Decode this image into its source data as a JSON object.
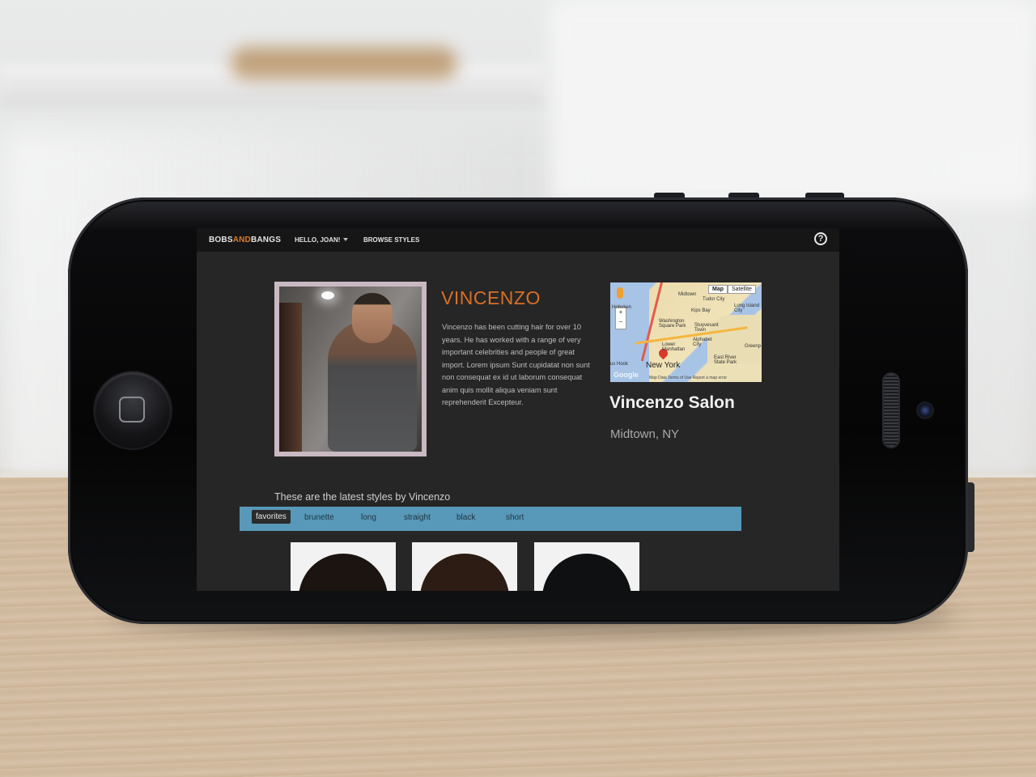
{
  "app": {
    "logo_part1": "BOBS",
    "logo_part2": "AND",
    "logo_part3": "BANGS",
    "nav_hello": "HELLO, JOAN!",
    "nav_browse": "BROWSE STYLES",
    "help_glyph": "?",
    "accent_color": "#e07a24",
    "filter_bar_color": "#5898b8"
  },
  "stylist": {
    "name": "VINCENZO",
    "bio": "Vincenzo has been cutting hair for over 10 years. He has worked with a range of very important celebrities and people of great import. Lorem ipsum Sunt cupidatat non sunt non consequat ex id ut laborum consequat anim quis mollit aliqua veniam sunt reprehenderit Excepteur."
  },
  "map": {
    "btn_map": "Map",
    "btn_satellite": "Satellite",
    "label_city": "New York",
    "label_midtown": "Midtown",
    "label_tudor": "Tudor City",
    "label_hoboken": "Hoboken",
    "label_kips": "Kips Bay",
    "label_long_island": "Long Island City",
    "label_washington": "Washington Square Park",
    "label_stuyvesant": "Stuyvesant Town",
    "label_lower_manhattan": "Lower Manhattan",
    "label_alphabet": "Alphabet City",
    "label_east_river": "East River State Park",
    "label_greenpoint": "Greenp",
    "label_hook": "us Hook",
    "google": "Google",
    "footer": "Map Data  Terms of Use  Report a map error",
    "zoom_in": "+",
    "zoom_out": "−"
  },
  "salon": {
    "name": "Vincenzo Salon",
    "location": "Midtown, NY"
  },
  "styles": {
    "heading": "These are the latest styles by Vincenzo",
    "tabs": [
      {
        "label": "favorites"
      },
      {
        "label": "brunette"
      },
      {
        "label": "long"
      },
      {
        "label": "straight"
      },
      {
        "label": "black"
      },
      {
        "label": "short"
      }
    ],
    "active_tab": "favorites"
  }
}
